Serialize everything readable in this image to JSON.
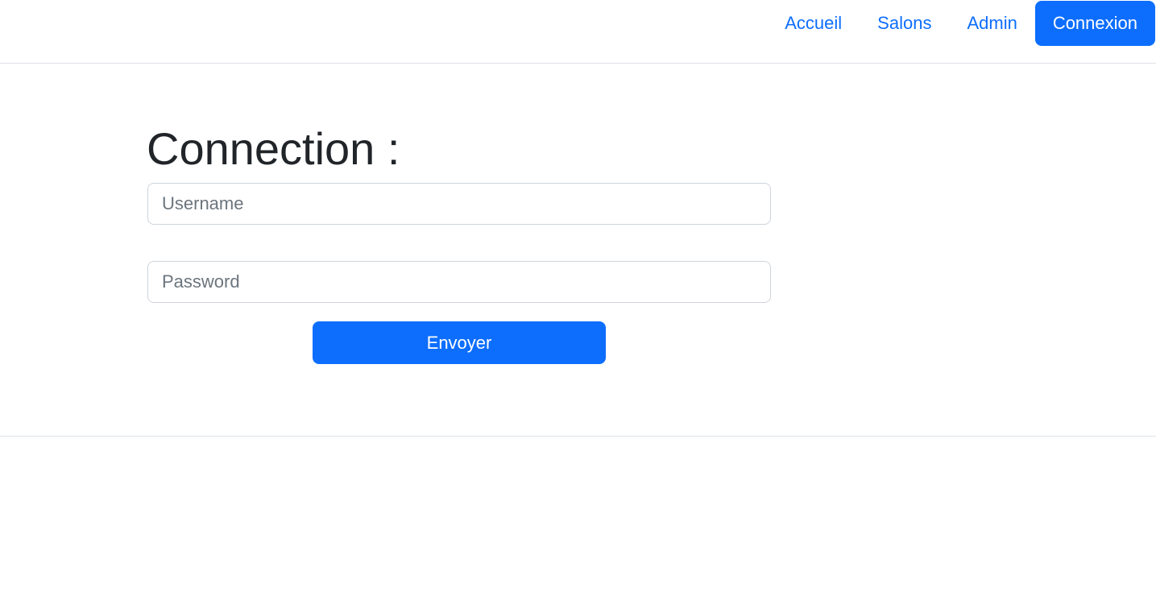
{
  "nav": {
    "items": [
      {
        "label": "Accueil",
        "active": false
      },
      {
        "label": "Salons",
        "active": false
      },
      {
        "label": "Admin",
        "active": false
      },
      {
        "label": "Connexion",
        "active": true
      }
    ]
  },
  "form": {
    "title": "Connection :",
    "username": {
      "value": "",
      "placeholder": "Username"
    },
    "password": {
      "value": "",
      "placeholder": "Password"
    },
    "submit_label": "Envoyer"
  },
  "colors": {
    "primary": "#0d6efd",
    "text": "#212529",
    "placeholder": "#6c757d",
    "border": "#ced4da",
    "divider": "#dee2e6"
  }
}
